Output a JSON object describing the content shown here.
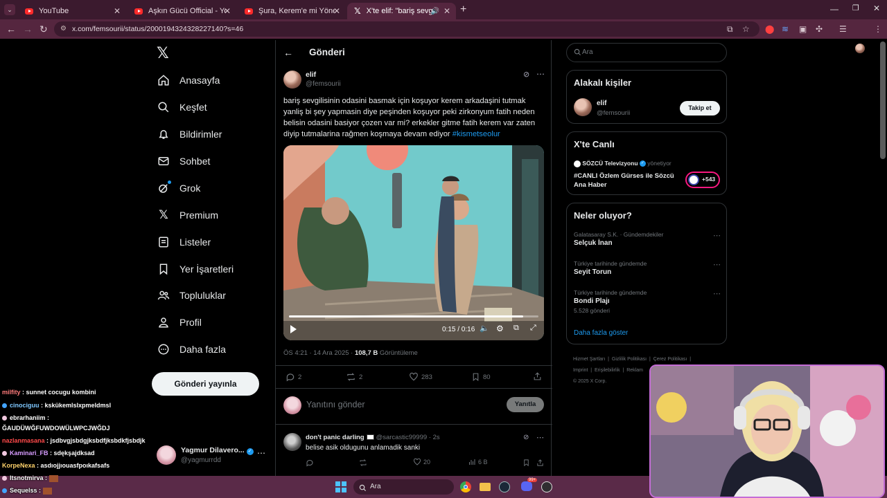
{
  "browser": {
    "tabs": [
      {
        "title": "YouTube"
      },
      {
        "title": "Aşkın Gücü Official - YouTube"
      },
      {
        "title": "Şura, Kerem'e mi Yöneldi? | Aşk"
      },
      {
        "title": "X'te elif: \"bariş sevgilisinin o"
      }
    ],
    "url": "x.com/femsourii/status/2000194324328227140?s=46"
  },
  "nav": {
    "items": [
      {
        "label": "Anasayfa",
        "icon": "home-icon"
      },
      {
        "label": "Keşfet",
        "icon": "search-icon"
      },
      {
        "label": "Bildirimler",
        "icon": "bell-icon"
      },
      {
        "label": "Sohbet",
        "icon": "mail-icon"
      },
      {
        "label": "Grok",
        "icon": "grok-icon"
      },
      {
        "label": "Premium",
        "icon": "x-icon"
      },
      {
        "label": "Listeler",
        "icon": "list-icon"
      },
      {
        "label": "Yer İşaretleri",
        "icon": "bookmark-icon"
      },
      {
        "label": "Topluluklar",
        "icon": "people-icon"
      },
      {
        "label": "Profil",
        "icon": "user-icon"
      },
      {
        "label": "Daha fazla",
        "icon": "more-circle-icon"
      }
    ],
    "post_button": "Gönderi yayınla",
    "account": {
      "name": "Yagmur Dilavero...",
      "handle": "@yagmurrdd"
    }
  },
  "main": {
    "header": "Gönderi",
    "post": {
      "author": "elif",
      "handle": "@femsourii",
      "text": "bariş sevgilisinin odasini basmak için koşuyor kerem arkadaşini tutmak yanliş bi şey yapmasin diye peşinden koşuyor peki zirkonyum fatih neden belisin odasini basiyor çozen var mi? erkekler gitme fatih kerem var zaten diyip tutmalarina rağmen koşmaya devam ediyor ",
      "hashtag": "#kismetseolur",
      "video": {
        "time": "0:15 / 0:16",
        "progress": 0.94
      },
      "meta_time": "ÖS 4:21 · 14 Ara 2025 · ",
      "views": "108,7 B",
      "views_label": " Görüntüleme",
      "stats": {
        "replies": "2",
        "reposts": "2",
        "likes": "283",
        "bookmarks": "80"
      }
    },
    "reply_placeholder": "Yanıtını gönder",
    "reply_button": "Yanıtla",
    "reply": {
      "author": "don't panic darling",
      "handle": "@sarcastic99999 · 2s",
      "text": "belise asik oldugunu anlamadik sanki",
      "likes": "20",
      "views": "6 B"
    }
  },
  "right": {
    "search_placeholder": "Ara",
    "related": {
      "title": "Alakalı kişiler",
      "name": "elif",
      "handle": "@femsourii",
      "follow": "Takip et"
    },
    "live": {
      "title": "X'te Canlı",
      "channel": "SÖZCÜ Televizyonu",
      "role": "yönetiyor",
      "text": "#CANLI Özlem Gürses ile Sözcü Ana Haber",
      "count": "+543"
    },
    "trends": {
      "title": "Neler oluyor?",
      "items": [
        {
          "category": "Galatasaray S.K. · Gündemdekiler",
          "name": "Selçuk İnan",
          "posts": ""
        },
        {
          "category": "Türkiye tarihinde gündemde",
          "name": "Seyit Torun",
          "posts": ""
        },
        {
          "category": "Türkiye tarihinde gündemde",
          "name": "Bondi Plajı",
          "posts": "5.528 gönderi"
        }
      ],
      "show_more": "Daha fazla göster"
    },
    "footer": {
      "links": [
        "Hizmet Şartları",
        "Gizlilik Politikası",
        "Çerez Politikası",
        "Imprint",
        "Erişilebilirlik",
        "Reklam"
      ],
      "copyright": "© 2025 X Corp."
    }
  },
  "chat": [
    {
      "user": "milfity",
      "msg": ": sunnet cocugu kombini",
      "color": "#ff7b7b"
    },
    {
      "user": "cinociguu",
      "msg": ": kskükemlslxpmeldmsl",
      "color": "#7fc8ff"
    },
    {
      "user": "ebrarhaniim",
      "msg": ":",
      "color": "#ffffff"
    },
    {
      "user": "",
      "msg": "ĞAUDÜWĞFUWDOWÜLWPCJWĞDJ",
      "color": "#ffffff"
    },
    {
      "user": "nazlanmasana",
      "msg": ": jsdbvgjsbdgjksbdfjksbdkfjsbdjk",
      "color": "#ff4a4a"
    },
    {
      "user": "Kaminari_FB",
      "msg": ": sdękşajdksad",
      "color": "#d79cff"
    },
    {
      "user": "KorpeNexa",
      "msg": ": asdıojjıouasfpoıkafsafs",
      "color": "#ffd36b"
    },
    {
      "user": "Itsnotmirva",
      "msg": ":",
      "color": "#ffffff"
    },
    {
      "user": "Sequelss",
      "msg": ":",
      "color": "#ffffff"
    }
  ],
  "taskbar": {
    "search": "Ara",
    "badge": "99+"
  }
}
